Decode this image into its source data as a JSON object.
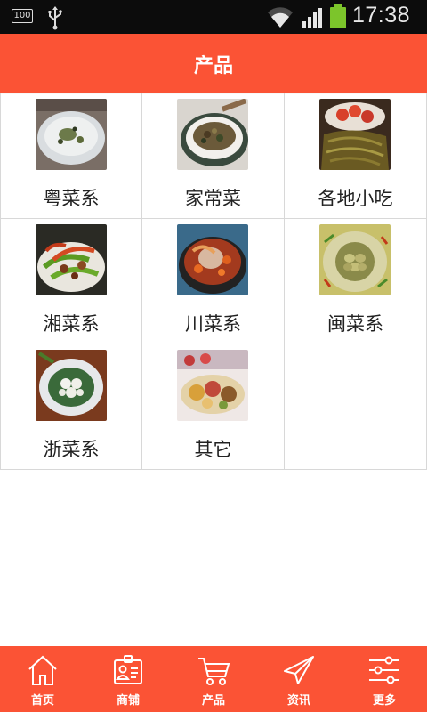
{
  "status_bar": {
    "battery_small_text": "100",
    "time": "17:38"
  },
  "header": {
    "title": "产品"
  },
  "products": [
    {
      "label": "粤菜系",
      "icon": "soup-bowl-image"
    },
    {
      "label": "家常菜",
      "icon": "stir-fry-dish-image"
    },
    {
      "label": "各地小吃",
      "icon": "snack-plate-image"
    },
    {
      "label": "湘菜系",
      "icon": "pepper-dish-image"
    },
    {
      "label": "川菜系",
      "icon": "sichuan-pot-image"
    },
    {
      "label": "闽菜系",
      "icon": "abalone-dish-image"
    },
    {
      "label": "浙菜系",
      "icon": "zhejiang-plate-image"
    },
    {
      "label": "其它",
      "icon": "assorted-platter-image"
    }
  ],
  "bottom_nav": [
    {
      "label": "首页",
      "icon": "home-icon"
    },
    {
      "label": "商铺",
      "icon": "shop-id-icon"
    },
    {
      "label": "产品",
      "icon": "cart-icon"
    },
    {
      "label": "资讯",
      "icon": "send-icon"
    },
    {
      "label": "更多",
      "icon": "sliders-icon"
    }
  ],
  "colors": {
    "brand": "#fb5335",
    "status_bar": "#0c0c0c",
    "battery_green": "#7cc52b"
  }
}
